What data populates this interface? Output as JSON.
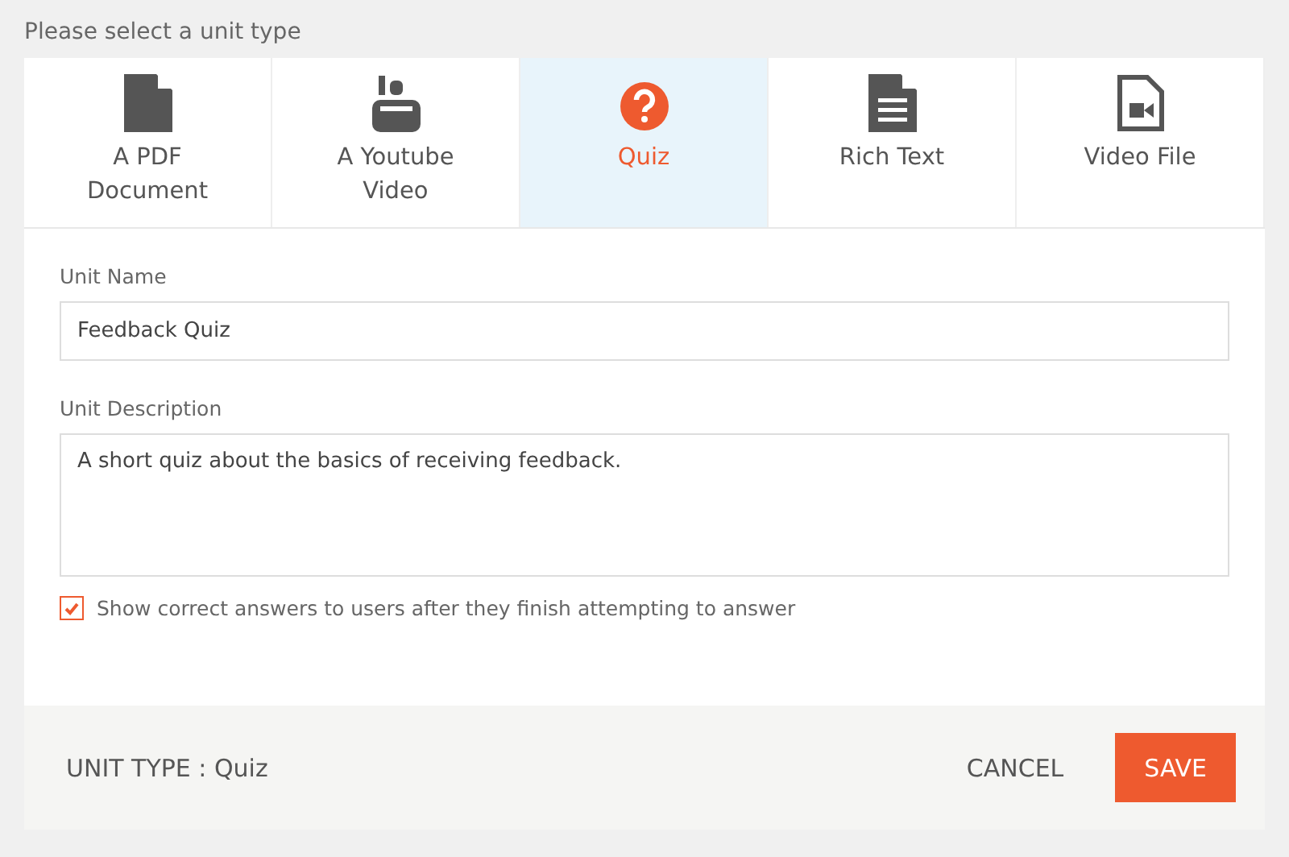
{
  "heading": "Please select a unit type",
  "tabs": [
    {
      "kind": "pdf",
      "label": "A PDF Document",
      "selected": false
    },
    {
      "kind": "youtube",
      "label": "A Youtube Video",
      "selected": false
    },
    {
      "kind": "quiz",
      "label": "Quiz",
      "selected": true
    },
    {
      "kind": "text",
      "label": "Rich Text",
      "selected": false
    },
    {
      "kind": "video",
      "label": "Video File",
      "selected": false
    }
  ],
  "unit_name": {
    "label": "Unit Name",
    "value": "Feedback Quiz"
  },
  "unit_description": {
    "label": "Unit Description",
    "value": "A short quiz about the basics of receiving feedback."
  },
  "show_answers": {
    "label": "Show correct answers to users after they finish attempting to answer",
    "checked": true
  },
  "footer": {
    "unit_type": "UNIT TYPE : Quiz",
    "buttons": [
      {
        "kind": "text",
        "label": "CANCEL"
      },
      {
        "kind": "primary",
        "label": "SAVE"
      }
    ]
  }
}
